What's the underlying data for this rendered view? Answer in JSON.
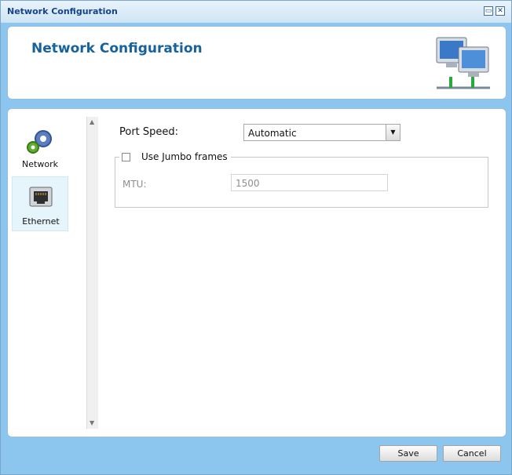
{
  "window": {
    "title": "Network Configuration"
  },
  "header": {
    "title": "Network Configuration",
    "icon": "network-computers-icon"
  },
  "sidebar": {
    "items": [
      {
        "label": "Network",
        "icon": "gears-icon",
        "selected": false
      },
      {
        "label": "Ethernet",
        "icon": "ethernet-port-icon",
        "selected": true
      }
    ]
  },
  "form": {
    "port_speed_label": "Port Speed:",
    "port_speed_value": "Automatic",
    "jumbo_label": "Use Jumbo frames",
    "jumbo_checked": false,
    "mtu_label": "MTU:",
    "mtu_value": "1500"
  },
  "buttons": {
    "save": "Save",
    "cancel": "Cancel"
  },
  "colors": {
    "accent": "#15629c",
    "window_bg": "#8cc6ee",
    "border": "#99bbe8"
  }
}
